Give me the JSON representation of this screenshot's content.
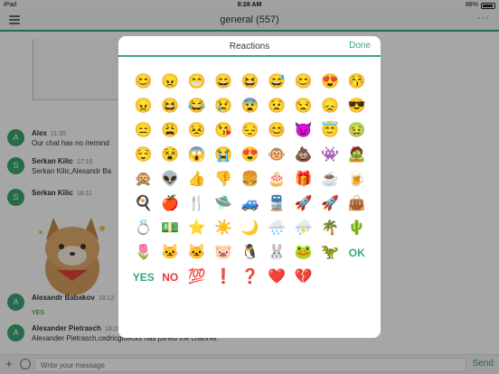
{
  "status": {
    "device": "iPad",
    "time": "8:28 AM",
    "battery": "88%",
    "battery_level": 0.88
  },
  "header": {
    "title": "general (557)",
    "more": "···"
  },
  "messages": [
    {
      "avatar": "A",
      "name": "Alex",
      "time": "11:35",
      "text": "Our chat has no /remind"
    },
    {
      "avatar": "S",
      "name": "Serkan Kilic",
      "time": "17:16",
      "text": "Serkan Kilic,Alexandr Ba"
    },
    {
      "avatar": "S",
      "name": "Serkan Kilic",
      "time": "18:11",
      "text": ""
    },
    {
      "avatar": "A",
      "name": "Alexandr Babakov",
      "time": "18:12",
      "text": ""
    },
    {
      "avatar": "A",
      "name": "Alexander Pietrasch",
      "time": "18:29",
      "text": "Alexander Pietrasch,cedricgluecks has joined the channel."
    }
  ],
  "small_yes": "YES",
  "composer": {
    "placeholder": "Write your message",
    "send_label": "Send"
  },
  "modal": {
    "title": "Reactions",
    "done_label": "Done",
    "emojis": [
      [
        "😊",
        "😠",
        "😁",
        "😄",
        "😆",
        "😅",
        "😊",
        "😍",
        "😚",
        "😠"
      ],
      [
        "😆",
        "😂",
        "😢",
        "😨",
        "😟",
        "😒",
        "😞",
        "😎",
        "😑",
        "😩"
      ],
      [
        "😣",
        "😘",
        "😔",
        "😊",
        "😈",
        "😇",
        "🤢",
        "😌",
        "😵",
        "😱"
      ],
      [
        "😭",
        "😍",
        "🐵",
        "💩",
        "👾",
        "🧟",
        "🙊",
        "👽",
        "👍",
        "👎"
      ],
      [
        "🍔",
        "🎂",
        "🎁",
        "☕",
        "🍺",
        "🍳",
        "🍎",
        "🍴",
        "🛸",
        "🚙"
      ],
      [
        "🚆",
        "🚀",
        "🚀",
        "👜",
        "💍",
        "💵",
        "⭐",
        "☀️",
        "🌙",
        "🌧️"
      ],
      [
        "⛈️",
        "🌴",
        "🌵",
        "🌷",
        "🐱",
        "🐱",
        "🐷",
        "🐧",
        "🐰",
        "🐸"
      ],
      [
        "🦖",
        "OK",
        "YES",
        "NO",
        "💯",
        "❗",
        "❓",
        "❤️",
        "💔"
      ]
    ]
  }
}
